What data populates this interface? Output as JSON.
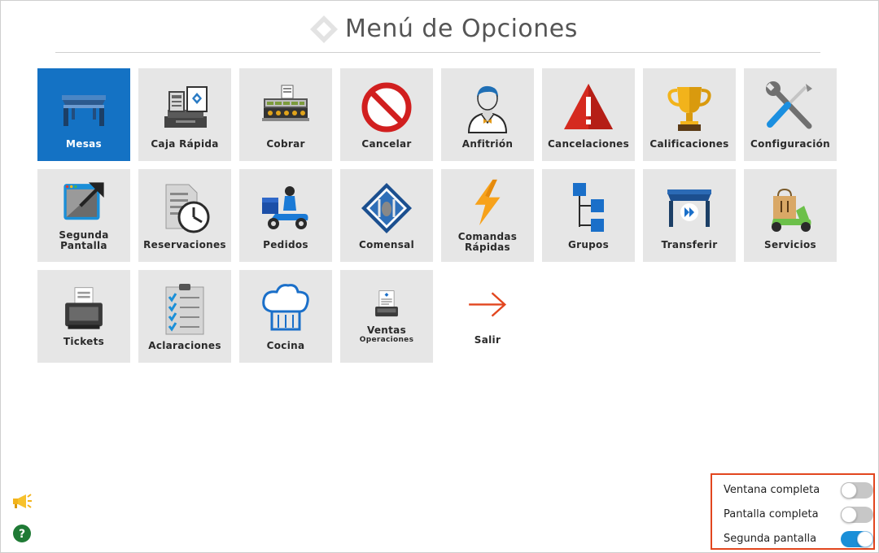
{
  "header": {
    "title": "Menú de Opciones"
  },
  "menu": {
    "mesas": "Mesas",
    "caja_rapida": "Caja Rápida",
    "cobrar": "Cobrar",
    "cancelar": "Cancelar",
    "anfitrion": "Anfitrión",
    "cancelaciones": "Cancelaciones",
    "calificaciones": "Calificaciones",
    "configuracion": "Configuración",
    "segunda_pantalla_1": "Segunda",
    "segunda_pantalla_2": "Pantalla",
    "reservaciones": "Reservaciones",
    "pedidos": "Pedidos",
    "comensal": "Comensal",
    "comandas_1": "Comandas",
    "comandas_2": "Rápidas",
    "grupos": "Grupos",
    "transferir": "Transferir",
    "servicios": "Servicios",
    "tickets": "Tickets",
    "aclaraciones": "Aclaraciones",
    "cocina": "Cocina",
    "ventas": "Ventas",
    "ventas_sub": "Operaciones",
    "salir": "Salir"
  },
  "toggles": {
    "ventana_completa": {
      "label": "Ventana completa",
      "on": false
    },
    "pantalla_completa": {
      "label": "Pantalla completa",
      "on": false
    },
    "segunda_pantalla": {
      "label": "Segunda pantalla",
      "on": true
    }
  },
  "colors": {
    "active_tile": "#1472c4",
    "tile": "#e6e6e6",
    "toggle_on": "#1a8fd8",
    "highlight_border": "#e2461e"
  },
  "icons": [
    "megaphone-icon",
    "help-icon"
  ]
}
